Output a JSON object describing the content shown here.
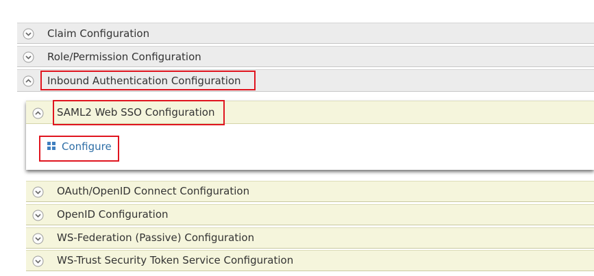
{
  "sections": {
    "claim": {
      "label": "Claim Configuration",
      "state": "collapsed"
    },
    "role": {
      "label": "Role/Permission Configuration",
      "state": "collapsed"
    },
    "inbound": {
      "label": "Inbound Authentication Configuration",
      "state": "expanded"
    }
  },
  "inbound_children": {
    "saml": {
      "label": "SAML2 Web SSO Configuration",
      "state": "expanded",
      "configure_label": "Configure"
    },
    "oauth": {
      "label": "OAuth/OpenID Connect Configuration",
      "state": "collapsed"
    },
    "openid": {
      "label": "OpenID Configuration",
      "state": "collapsed"
    },
    "wsfed": {
      "label": "WS-Federation (Passive) Configuration",
      "state": "collapsed"
    },
    "wstrust": {
      "label": "WS-Trust Security Token Service Configuration",
      "state": "collapsed"
    }
  },
  "icons": {
    "expand": "chevron-down-circle-icon",
    "collapse": "chevron-up-circle-icon",
    "configure": "grid-icon"
  },
  "colors": {
    "highlight_border": "#e0141e",
    "link": "#2e6ea6",
    "section_bg": "#ececec",
    "subsection_bg": "#f5f5dc"
  }
}
